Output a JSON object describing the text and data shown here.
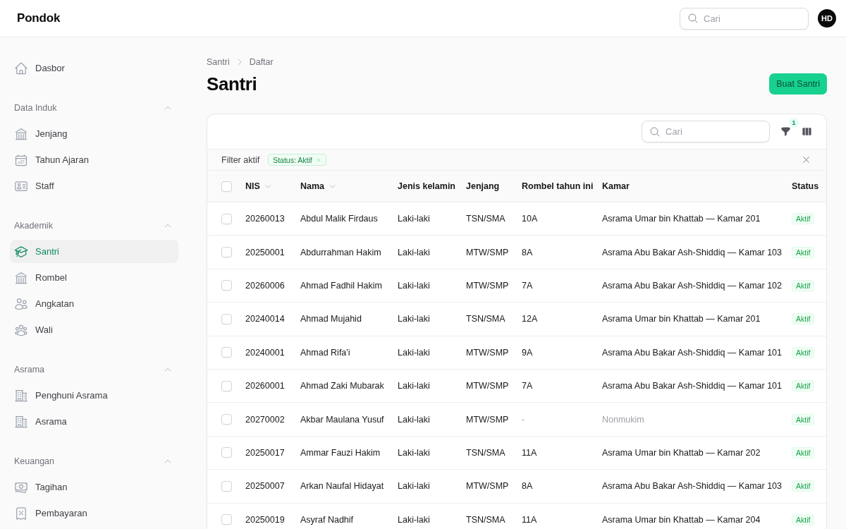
{
  "header": {
    "brand": "Pondok",
    "search": {
      "placeholder": "Cari"
    },
    "avatar": "HD"
  },
  "sidebar": {
    "items": [
      {
        "label": "Dasbor",
        "selected": false
      }
    ],
    "groups": [
      {
        "label": "Data Induk",
        "expanded": true,
        "items": [
          {
            "label": "Jenjang",
            "selected": false
          },
          {
            "label": "Tahun Ajaran",
            "selected": false
          },
          {
            "label": "Staff",
            "selected": false
          }
        ]
      },
      {
        "label": "Akademik",
        "expanded": true,
        "items": [
          {
            "label": "Santri",
            "selected": true
          },
          {
            "label": "Rombel",
            "selected": false
          },
          {
            "label": "Angkatan",
            "selected": false
          },
          {
            "label": "Wali",
            "selected": false
          }
        ]
      },
      {
        "label": "Asrama",
        "expanded": true,
        "items": [
          {
            "label": "Penghuni Asrama",
            "selected": false
          },
          {
            "label": "Asrama",
            "selected": false
          }
        ]
      },
      {
        "label": "Keuangan",
        "expanded": true,
        "items": [
          {
            "label": "Tagihan",
            "selected": false
          },
          {
            "label": "Pembayaran",
            "selected": false
          }
        ]
      }
    ]
  },
  "page": {
    "breadcrumb": [
      "Santri",
      "Daftar"
    ],
    "title": "Santri",
    "create_button": "Buat Santri"
  },
  "table": {
    "search": {
      "placeholder": "Cari"
    },
    "filter_count": "1",
    "active_filters": {
      "label": "Filter aktif",
      "chips": [
        {
          "label": "Status: Aktif"
        }
      ]
    },
    "select_all": {
      "checked": false
    },
    "columns": [
      {
        "label": "NIS",
        "sortable": true
      },
      {
        "label": "Nama",
        "sortable": true
      },
      {
        "label": "Jenis kelamin",
        "sortable": false
      },
      {
        "label": "Jenjang",
        "sortable": false
      },
      {
        "label": "Rombel tahun ini",
        "sortable": false
      },
      {
        "label": "Kamar",
        "sortable": false
      },
      {
        "label": "Status",
        "sortable": false
      }
    ],
    "rows": [
      {
        "checked": false,
        "nis": "20260013",
        "nama": "Abdul Malik Firdaus",
        "jenis_kelamin": "Laki-laki",
        "jenjang": "TSN/SMA",
        "rombel": {
          "text": "10A",
          "muted": false
        },
        "kamar": {
          "text": "Asrama Umar bin Khattab — Kamar 201",
          "muted": false
        },
        "status": "Aktif"
      },
      {
        "checked": false,
        "nis": "20250001",
        "nama": "Abdurrahman Hakim",
        "jenis_kelamin": "Laki-laki",
        "jenjang": "MTW/SMP",
        "rombel": {
          "text": "8A",
          "muted": false
        },
        "kamar": {
          "text": "Asrama Abu Bakar Ash-Shiddiq — Kamar 103",
          "muted": false
        },
        "status": "Aktif"
      },
      {
        "checked": false,
        "nis": "20260006",
        "nama": "Ahmad Fadhil Hakim",
        "jenis_kelamin": "Laki-laki",
        "jenjang": "MTW/SMP",
        "rombel": {
          "text": "7A",
          "muted": false
        },
        "kamar": {
          "text": "Asrama Abu Bakar Ash-Shiddiq — Kamar 102",
          "muted": false
        },
        "status": "Aktif"
      },
      {
        "checked": false,
        "nis": "20240014",
        "nama": "Ahmad Mujahid",
        "jenis_kelamin": "Laki-laki",
        "jenjang": "TSN/SMA",
        "rombel": {
          "text": "12A",
          "muted": false
        },
        "kamar": {
          "text": "Asrama Umar bin Khattab — Kamar 201",
          "muted": false
        },
        "status": "Aktif"
      },
      {
        "checked": false,
        "nis": "20240001",
        "nama": "Ahmad Rifa'i",
        "jenis_kelamin": "Laki-laki",
        "jenjang": "MTW/SMP",
        "rombel": {
          "text": "9A",
          "muted": false
        },
        "kamar": {
          "text": "Asrama Abu Bakar Ash-Shiddiq — Kamar 101",
          "muted": false
        },
        "status": "Aktif"
      },
      {
        "checked": false,
        "nis": "20260001",
        "nama": "Ahmad Zaki Mubarak",
        "jenis_kelamin": "Laki-laki",
        "jenjang": "MTW/SMP",
        "rombel": {
          "text": "7A",
          "muted": false
        },
        "kamar": {
          "text": "Asrama Abu Bakar Ash-Shiddiq — Kamar 101",
          "muted": false
        },
        "status": "Aktif"
      },
      {
        "checked": false,
        "nis": "20270002",
        "nama": "Akbar Maulana Yusuf",
        "jenis_kelamin": "Laki-laki",
        "jenjang": "MTW/SMP",
        "rombel": {
          "text": "-",
          "muted": true
        },
        "kamar": {
          "text": "Nonmukim",
          "muted": true
        },
        "status": "Aktif"
      },
      {
        "checked": false,
        "nis": "20250017",
        "nama": "Ammar Fauzi Hakim",
        "jenis_kelamin": "Laki-laki",
        "jenjang": "TSN/SMA",
        "rombel": {
          "text": "11A",
          "muted": false
        },
        "kamar": {
          "text": "Asrama Umar bin Khattab — Kamar 202",
          "muted": false
        },
        "status": "Aktif"
      },
      {
        "checked": false,
        "nis": "20250007",
        "nama": "Arkan Naufal Hidayat",
        "jenis_kelamin": "Laki-laki",
        "jenjang": "MTW/SMP",
        "rombel": {
          "text": "8A",
          "muted": false
        },
        "kamar": {
          "text": "Asrama Abu Bakar Ash-Shiddiq — Kamar 103",
          "muted": false
        },
        "status": "Aktif"
      },
      {
        "checked": false,
        "nis": "20250019",
        "nama": "Asyraf Nadhif",
        "jenis_kelamin": "Laki-laki",
        "jenjang": "TSN/SMA",
        "rombel": {
          "text": "11A",
          "muted": false
        },
        "kamar": {
          "text": "Asrama Umar bin Khattab — Kamar 204",
          "muted": false
        },
        "status": "Aktif"
      }
    ]
  }
}
